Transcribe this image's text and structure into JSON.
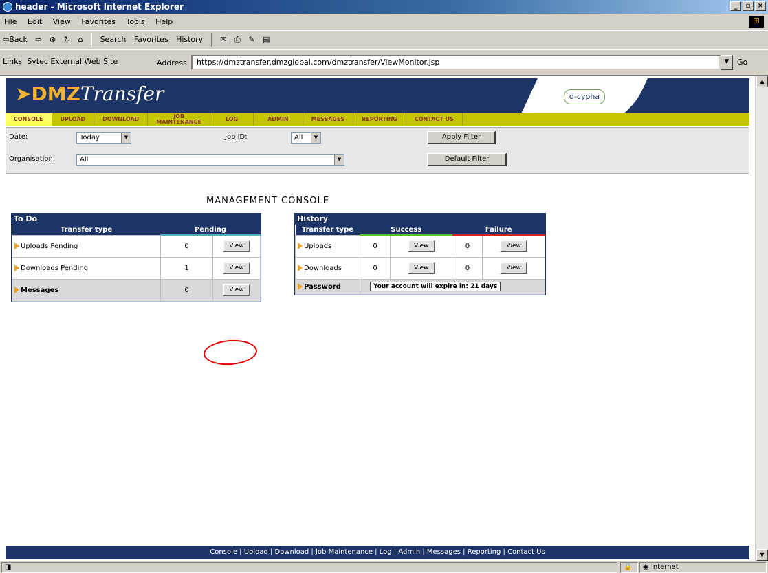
{
  "window": {
    "title": "header - Microsoft Internet Explorer",
    "controls": [
      "_",
      "▫",
      "×"
    ]
  },
  "menu": [
    "File",
    "Edit",
    "View",
    "Favorites",
    "Tools",
    "Help"
  ],
  "toolbar": {
    "back": "⇦Back",
    "forward": "⇨",
    "stop": "⊗",
    "refresh": "↻",
    "home": "⌂",
    "search": "Search",
    "favorites": "Favorites",
    "history": "History"
  },
  "address": {
    "links_label": "Links",
    "links_item": "Sytec External Web Site",
    "label": "Address",
    "url": "https://dmztransfer.dmzglobal.com/dmztransfer/ViewMonitor.jsp",
    "go": "Go"
  },
  "banner": {
    "logo_dmz": "DMZ",
    "logo_transfer": "Transfer",
    "partner": "d-cypha"
  },
  "nav": [
    {
      "label": "CONSOLE",
      "active": true
    },
    {
      "label": "UPLOAD"
    },
    {
      "label": "DOWNLOAD"
    },
    {
      "label": "JOB MAINTENANCE",
      "line1": "JOB",
      "line2": "MAINTENANCE"
    },
    {
      "label": "LOG"
    },
    {
      "label": "ADMIN"
    },
    {
      "label": "MESSAGES"
    },
    {
      "label": "REPORTING"
    },
    {
      "label": "CONTACT US"
    }
  ],
  "filter": {
    "date_label": "Date:",
    "date_value": "Today",
    "jobid_label": "Job ID:",
    "jobid_value": "All",
    "org_label": "Organisation:",
    "org_value": "All",
    "apply": "Apply Filter",
    "default": "Default Filter"
  },
  "console_title": "MANAGEMENT CONSOLE",
  "todo": {
    "header": "To Do",
    "col_type": "Transfer type",
    "col_pending": "Pending",
    "rows": [
      {
        "label": "Uploads Pending",
        "count": "0",
        "button": "View"
      },
      {
        "label": "Downloads Pending",
        "count": "1",
        "button": "View"
      },
      {
        "label": "Messages",
        "count": "0",
        "button": "View"
      }
    ]
  },
  "history": {
    "header": "History",
    "col_type": "Transfer type",
    "col_success": "Success",
    "col_failure": "Failure",
    "rows": [
      {
        "label": "Uploads",
        "success": "0",
        "failure": "0",
        "button": "View"
      },
      {
        "label": "Downloads",
        "success": "0",
        "failure": "0",
        "button": "View"
      }
    ],
    "password_label": "Password",
    "password_msg": "Your account will expire in: 21 days"
  },
  "footer_links": [
    "Console",
    "Upload",
    "Download",
    "Job Maintenance",
    "Log",
    "Admin",
    "Messages",
    "Reporting",
    "Contact Us"
  ],
  "status": {
    "zone": "Internet"
  },
  "colors": {
    "navy": "#1d3566",
    "nav_bar": "#c6c600",
    "accent_orange": "#f2b233",
    "highlight_circle": "#e00000"
  }
}
